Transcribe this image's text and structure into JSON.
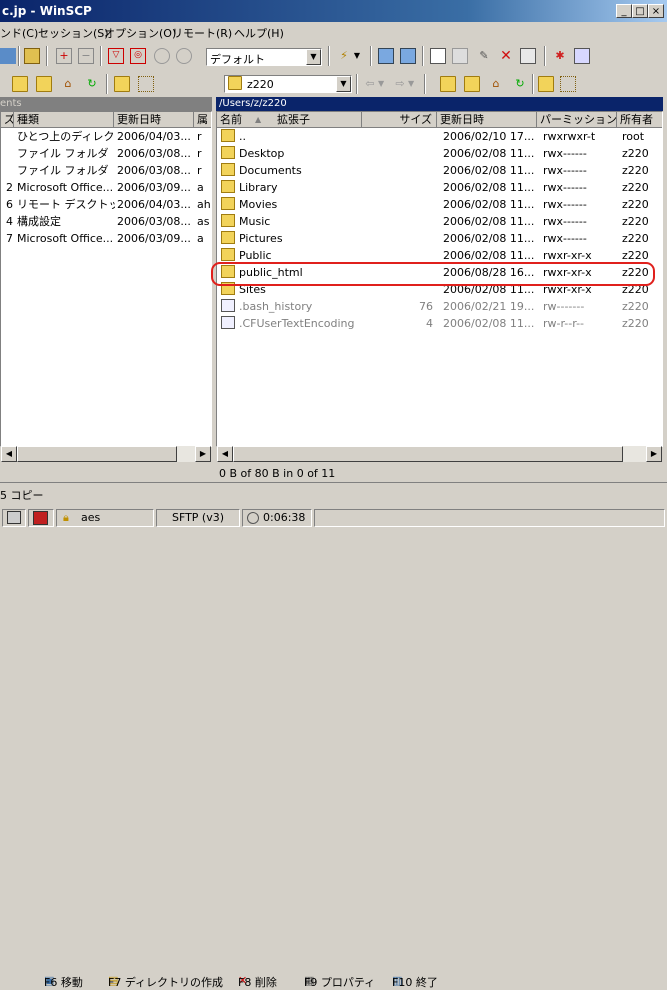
{
  "window": {
    "title": "c.jp - WinSCP"
  },
  "menu": [
    "ンド(C)",
    "セッション(S)",
    "オプション(O)",
    "リモート(R)",
    "ヘルプ(H)"
  ],
  "toolbar": {
    "profile_value": "デフォルト"
  },
  "remote_nav": {
    "dir_value": "z220"
  },
  "left": {
    "path": "ents",
    "columns": [
      "ズ",
      "種類",
      "更新日時",
      "属"
    ],
    "rows": [
      {
        "size": "",
        "type": "ひとつ上のディレク...",
        "date": "2006/04/03...",
        "attr": "r"
      },
      {
        "size": "",
        "type": "ファイル フォルダ",
        "date": "2006/03/08...",
        "attr": "r"
      },
      {
        "size": "",
        "type": "ファイル フォルダ",
        "date": "2006/03/08...",
        "attr": "r"
      },
      {
        "size": "2",
        "type": "Microsoft Office...",
        "date": "2006/03/09...",
        "attr": "a"
      },
      {
        "size": "6",
        "type": "リモート デスクトッ...",
        "date": "2006/04/03...",
        "attr": "ah"
      },
      {
        "size": "4",
        "type": "構成設定",
        "date": "2006/03/08...",
        "attr": "as"
      },
      {
        "size": "7",
        "type": "Microsoft Office...",
        "date": "2006/03/09...",
        "attr": "a"
      }
    ]
  },
  "right": {
    "path": "/Users/z/z220",
    "columns": [
      "名前",
      "拡張子",
      "サイズ",
      "更新日時",
      "パーミッション",
      "所有者"
    ],
    "rows": [
      {
        "icon": "parent-dir-icon",
        "name": "..",
        "size": "",
        "date": "2006/02/10 17...",
        "perm": "rwxrwxr-t",
        "owner": "root",
        "hidden": false
      },
      {
        "icon": "folder-icon",
        "name": "Desktop",
        "size": "",
        "date": "2006/02/08 11...",
        "perm": "rwx------",
        "owner": "z220",
        "hidden": false
      },
      {
        "icon": "folder-icon",
        "name": "Documents",
        "size": "",
        "date": "2006/02/08 11...",
        "perm": "rwx------",
        "owner": "z220",
        "hidden": false
      },
      {
        "icon": "folder-icon",
        "name": "Library",
        "size": "",
        "date": "2006/02/08 11...",
        "perm": "rwx------",
        "owner": "z220",
        "hidden": false
      },
      {
        "icon": "folder-icon",
        "name": "Movies",
        "size": "",
        "date": "2006/02/08 11...",
        "perm": "rwx------",
        "owner": "z220",
        "hidden": false
      },
      {
        "icon": "folder-icon",
        "name": "Music",
        "size": "",
        "date": "2006/02/08 11...",
        "perm": "rwx------",
        "owner": "z220",
        "hidden": false
      },
      {
        "icon": "folder-icon",
        "name": "Pictures",
        "size": "",
        "date": "2006/02/08 11...",
        "perm": "rwx------",
        "owner": "z220",
        "hidden": false
      },
      {
        "icon": "folder-icon",
        "name": "Public",
        "size": "",
        "date": "2006/02/08 11...",
        "perm": "rwxr-xr-x",
        "owner": "z220",
        "hidden": false
      },
      {
        "icon": "folder-icon",
        "name": "public_html",
        "size": "",
        "date": "2006/08/28 16...",
        "perm": "rwxr-xr-x",
        "owner": "z220",
        "hidden": false
      },
      {
        "icon": "folder-icon",
        "name": "Sites",
        "size": "",
        "date": "2006/02/08 11...",
        "perm": "rwxr-xr-x",
        "owner": "z220",
        "hidden": false
      },
      {
        "icon": "file-icon",
        "name": ".bash_history",
        "size": "76",
        "date": "2006/02/21 19...",
        "perm": "rw-------",
        "owner": "z220",
        "hidden": true
      },
      {
        "icon": "file-icon",
        "name": ".CFUserTextEncoding",
        "size": "4",
        "date": "2006/02/08 11...",
        "perm": "rw-r--r--",
        "owner": "z220",
        "hidden": true
      }
    ],
    "highlight_color": "#e0201c"
  },
  "summary": "0 B of 80 B in 0 of 11",
  "fkeys": [
    "5 コピー",
    "F6 移動",
    "F7 ディレクトリの作成",
    "F8 削除",
    "F9 プロパティ",
    "F10 終了"
  ],
  "status": {
    "cipher": "aes",
    "protocol": "SFTP (v3)",
    "elapsed": "0:06:38"
  }
}
